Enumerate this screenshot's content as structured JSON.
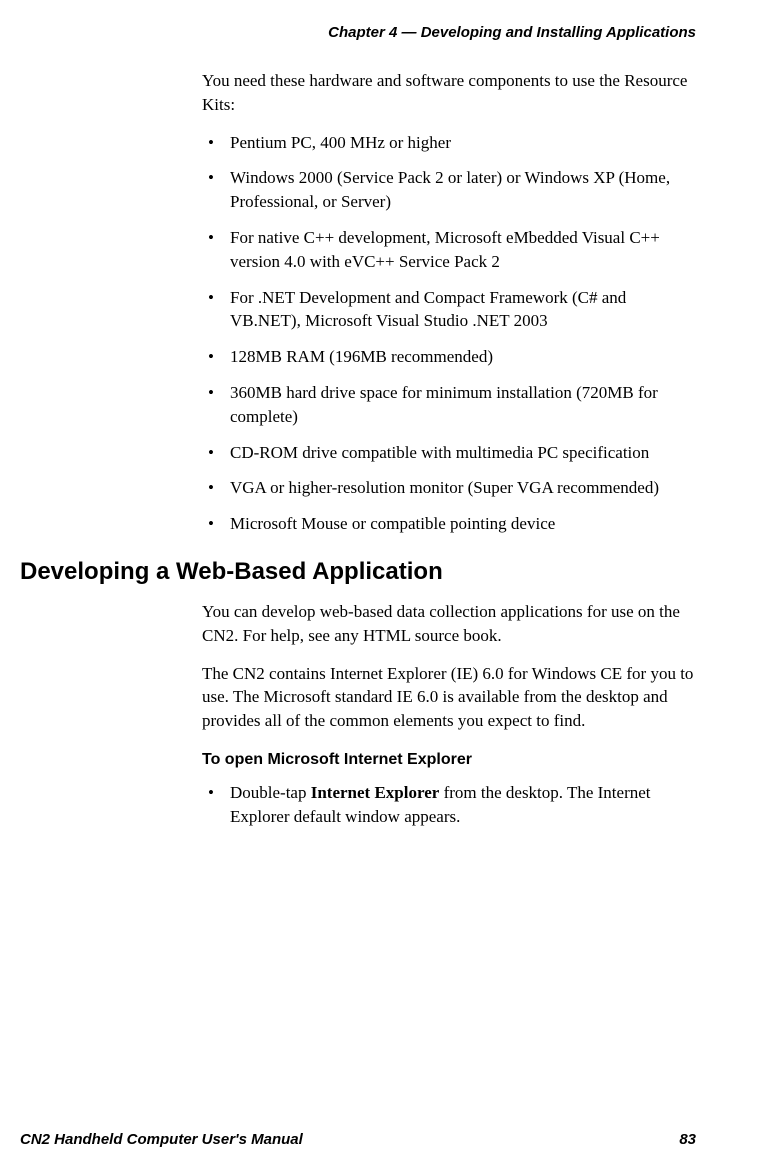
{
  "header": {
    "chapter_title": "Chapter 4 — Developing and Installing Applications"
  },
  "intro": "You need these hardware and software components to use the Resource Kits:",
  "requirements": [
    "Pentium PC, 400 MHz or higher",
    "Windows 2000 (Service Pack 2 or later) or Windows XP (Home, Professional, or Server)",
    "For native C++ development, Microsoft eMbedded Visual C++ version 4.0 with eVC++ Service Pack 2",
    "For .NET Development and Compact Framework (C# and VB.NET), Microsoft Visual Studio .NET 2003",
    "128MB RAM (196MB recommended)",
    "360MB hard drive space for minimum installation (720MB for complete)",
    "CD-ROM drive compatible with multimedia PC specification",
    "VGA or higher-resolution monitor (Super VGA recommended)",
    "Microsoft Mouse or compatible pointing device"
  ],
  "section": {
    "heading": "Developing a Web-Based Application",
    "para1": "You can develop web-based data collection applications for use on the CN2. For help, see any HTML source book.",
    "para2": "The CN2 contains Internet Explorer (IE) 6.0 for Windows CE for you to use. The Microsoft standard IE 6.0 is available from the desktop and provides all of the common elements you expect to find.",
    "sub_heading": "To open Microsoft Internet Explorer",
    "step_prefix": "Double-tap ",
    "step_bold": "Internet Explorer",
    "step_suffix": " from the desktop. The Internet Explorer default window appears."
  },
  "footer": {
    "manual_title": "CN2 Handheld Computer User's Manual",
    "page_number": "83"
  }
}
